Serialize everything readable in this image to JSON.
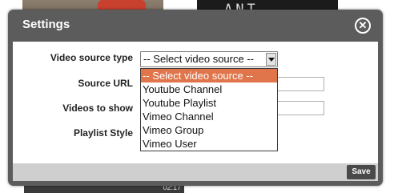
{
  "background": {
    "right_thumb_text": "ANT BALLET",
    "bottom_thumb_duration": "02:17"
  },
  "dialog": {
    "title": "Settings",
    "close_icon": "close-circle-icon",
    "save_label": "Save"
  },
  "form": {
    "video_source_type": {
      "label": "Video source type",
      "selected": "-- Select video source --",
      "options": [
        "-- Select video source --",
        "Youtube Channel",
        "Youtube Playlist",
        "Vimeo Channel",
        "Vimeo Group",
        "Vimeo User"
      ],
      "highlighted_option": 0
    },
    "source_url": {
      "label": "Source URL",
      "value": ""
    },
    "videos_to_show": {
      "label": "Videos to show",
      "value": ""
    },
    "playlist_style": {
      "label": "Playlist Style"
    }
  },
  "colors": {
    "dialog_frame": "#5c5c5c",
    "highlight": "#e0744a",
    "footer": "#cfcfcf",
    "save_button": "#4a4a4a"
  }
}
